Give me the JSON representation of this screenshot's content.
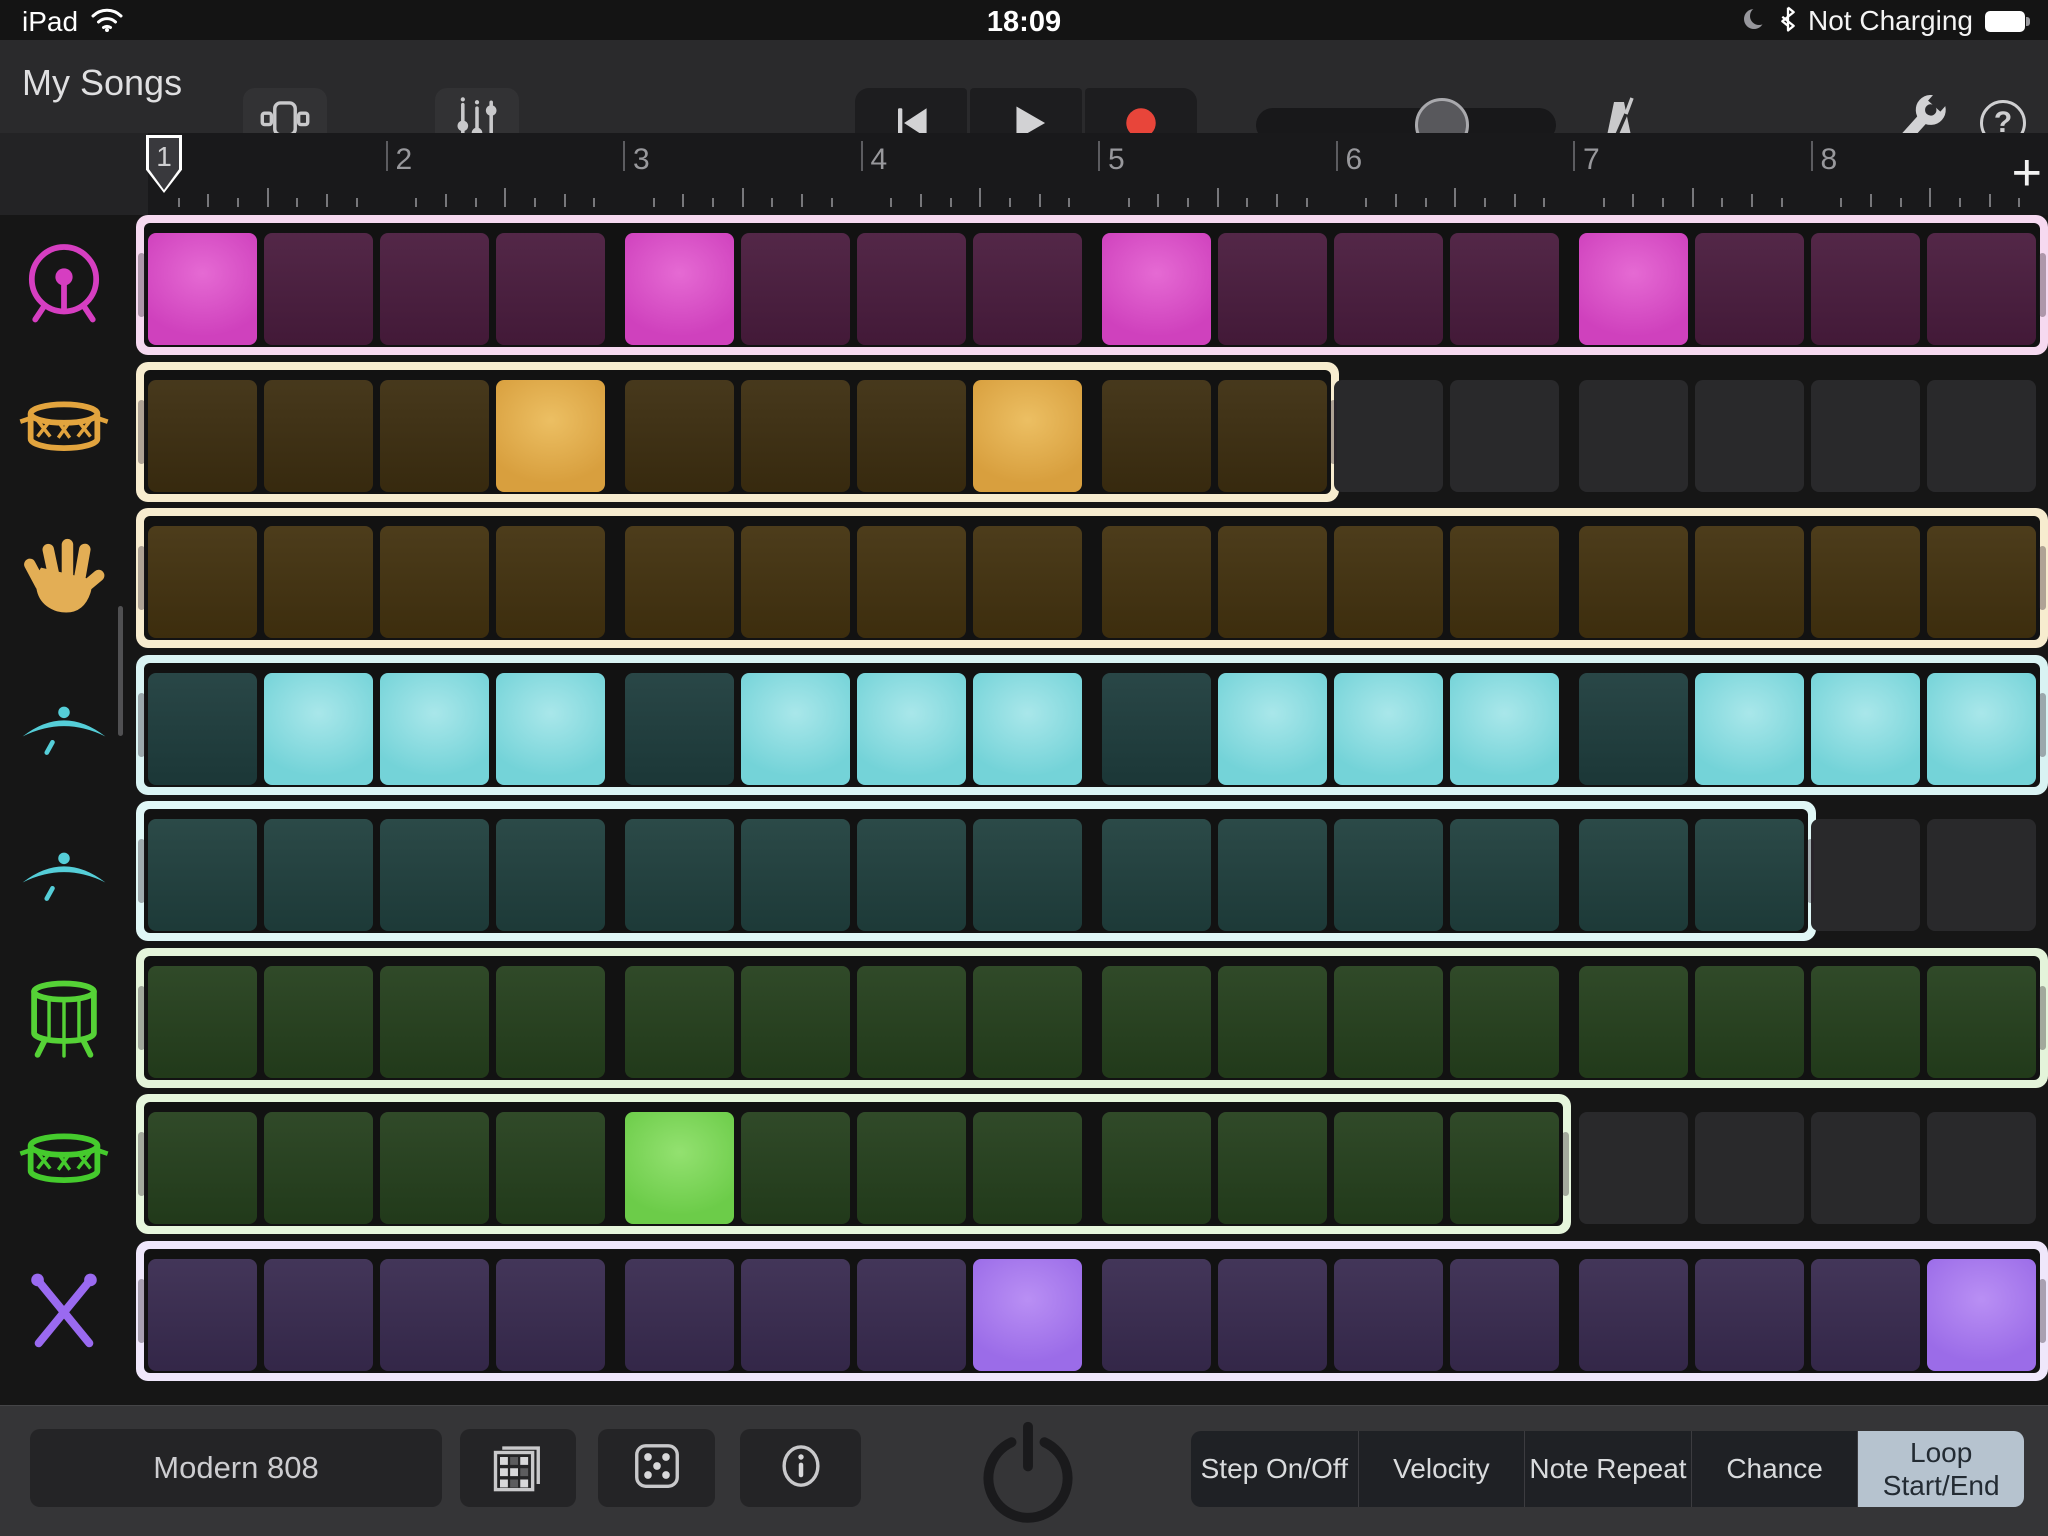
{
  "status_bar": {
    "device_label": "iPad",
    "time": "18:09",
    "charging_status": "Not Charging"
  },
  "toolbar": {
    "my_songs_label": "My Songs",
    "volume_slider_position": 0.62
  },
  "ruler": {
    "bar_numbers": [
      "1",
      "2",
      "3",
      "4",
      "5",
      "6",
      "7",
      "8"
    ],
    "playhead_bar": "1",
    "add_label": "+"
  },
  "sequencer": {
    "steps_per_row": 16,
    "group_size": 4,
    "outside_cell_color": "#29292b",
    "rows": [
      {
        "name": "kick-drum",
        "icon": "bass-drum-icon",
        "icon_color": "#d63ec1",
        "loop_steps": 16,
        "active_steps": [
          1,
          5,
          9,
          13
        ],
        "colors": {
          "border": "#f6d9f0",
          "dim": "#4a1c3e",
          "bright": "#cf41bd",
          "bright_hi": "#e56ad3"
        }
      },
      {
        "name": "snare",
        "icon": "snare-drum-icon",
        "icon_color": "#e2a43e",
        "loop_steps": 10,
        "active_steps": [
          4,
          8
        ],
        "colors": {
          "border": "#f7eccf",
          "dim": "#3d2e10",
          "bright": "#d89f3e",
          "bright_hi": "#ecbf63"
        }
      },
      {
        "name": "hand-clap",
        "icon": "hand-clap-icon",
        "icon_color": "#e3ae55",
        "loop_steps": 16,
        "active_steps": [],
        "colors": {
          "border": "#f7eccf",
          "dim": "#43320f",
          "bright": "#d89f3e",
          "bright_hi": "#ecbf63"
        }
      },
      {
        "name": "closed-hi-hat",
        "icon": "cymbal-icon",
        "icon_color": "#55ced8",
        "loop_steps": 16,
        "active_steps": [
          2,
          3,
          4,
          6,
          7,
          8,
          10,
          11,
          12,
          14,
          15,
          16
        ],
        "colors": {
          "border": "#d9f3f3",
          "dim": "#1e3d3d",
          "bright": "#74d3d8",
          "bright_hi": "#a9e7ea"
        }
      },
      {
        "name": "open-hi-hat",
        "icon": "cymbal-icon",
        "icon_color": "#55ced8",
        "loop_steps": 14,
        "active_steps": [],
        "colors": {
          "border": "#e0f7f6",
          "dim": "#20403e",
          "bright": "#74d3d8",
          "bright_hi": "#a9e7ea"
        }
      },
      {
        "name": "low-tom",
        "icon": "floor-tom-icon",
        "icon_color": "#55d236",
        "loop_steps": 16,
        "active_steps": [],
        "colors": {
          "border": "#e4f4da",
          "dim": "#25401d",
          "bright": "#6ccc49",
          "bright_hi": "#93e170"
        }
      },
      {
        "name": "snare-2",
        "icon": "snare-drum-icon",
        "icon_color": "#45cb2d",
        "loop_steps": 12,
        "active_steps": [
          5
        ],
        "colors": {
          "border": "#e6f6dc",
          "dim": "#25401d",
          "bright": "#6ccc49",
          "bright_hi": "#93e170"
        }
      },
      {
        "name": "drumsticks",
        "icon": "drumsticks-icon",
        "icon_color": "#9a6af0",
        "loop_steps": 16,
        "active_steps": [
          8,
          16
        ],
        "colors": {
          "border": "#efe7fb",
          "dim": "#392b50",
          "bright": "#9b6ce8",
          "bright_hi": "#b98ff4"
        }
      }
    ]
  },
  "bottom_bar": {
    "kit_name": "Modern 808",
    "mode_buttons": [
      {
        "label": "Step On/Off",
        "selected": false
      },
      {
        "label": "Velocity",
        "selected": false
      },
      {
        "label": "Note Repeat",
        "selected": false
      },
      {
        "label": "Chance",
        "selected": false
      },
      {
        "label": "Loop Start/End",
        "selected": true
      }
    ]
  }
}
